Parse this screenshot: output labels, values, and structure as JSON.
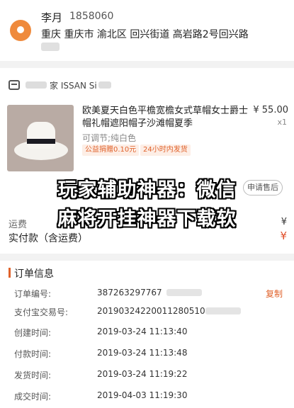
{
  "address": {
    "name": "李月",
    "phone": "1858060",
    "line": "重庆 重庆市 渝北区 回兴街道 高岩路2号回兴路"
  },
  "store": {
    "name": "家 ISSAN Si"
  },
  "product": {
    "title": "欧美夏天白色平檐宽檐女式草帽女士爵士帽礼帽遮阳帽子沙滩帽夏季",
    "price": "¥ 55.00",
    "qty": "x1",
    "spec": "可调节;纯白色",
    "tag_charity": "公益捐赠0.10元",
    "tag_ship": "24小时内发货",
    "after_sale": "申请售后"
  },
  "summary": {
    "freight_label": "运费",
    "freight_value": "¥",
    "paid_label": "实付款（含运费）",
    "paid_value": "¥"
  },
  "order_info": {
    "title": "订单信息",
    "copy_label": "复制",
    "rows": [
      {
        "label": "订单编号:",
        "value": "387263297767"
      },
      {
        "label": "支付宝交易号:",
        "value": "20190324220011280510"
      },
      {
        "label": "创建时间:",
        "value": "2019-03-24 11:13:40"
      },
      {
        "label": "付款时间:",
        "value": "2019-03-24 11:13:48"
      },
      {
        "label": "发货时间:",
        "value": "2019-03-24 11:19:22"
      },
      {
        "label": "成交时间:",
        "value": "2019-04-03 11:19:30"
      }
    ]
  },
  "overlay": {
    "line1": "玩家辅助神器：微信",
    "line2": "麻将开挂神器下载软"
  },
  "icons": [
    "location-pin-icon",
    "store-icon"
  ],
  "colors": {
    "accent": "#e0622b",
    "pin": "#ef8a3c"
  }
}
